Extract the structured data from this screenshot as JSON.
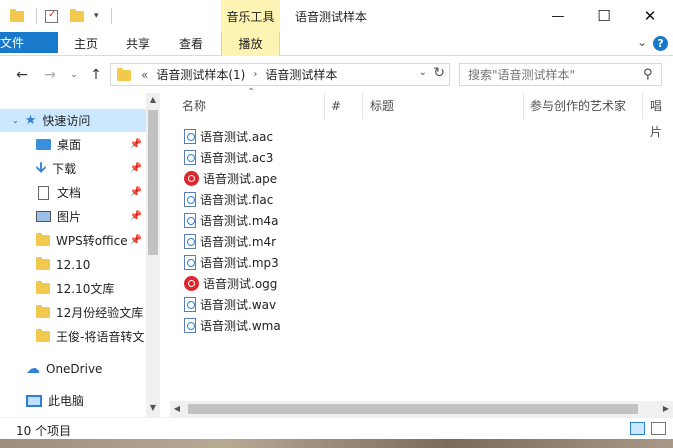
{
  "titlebar": {
    "contextual_tab_group": "音乐工具",
    "window_title": "语音测试样本",
    "minimize": "—",
    "maximize": "☐",
    "close": "✕"
  },
  "ribbon": {
    "tabs": [
      "文件",
      "主页",
      "共享",
      "查看",
      "播放"
    ],
    "help": "?"
  },
  "address": {
    "overflow": "«",
    "crumbs": [
      "语音测试样本(1)",
      "语音测试样本"
    ],
    "separator": "›"
  },
  "search": {
    "placeholder": "搜索\"语音测试样本\""
  },
  "navpane": {
    "items": [
      {
        "label": "快速访问",
        "icon": "star-icon"
      },
      {
        "label": "桌面",
        "icon": "desktop-icon",
        "pinned": true
      },
      {
        "label": "下载",
        "icon": "download-icon",
        "pinned": true
      },
      {
        "label": "文档",
        "icon": "document-icon",
        "pinned": true
      },
      {
        "label": "图片",
        "icon": "pictures-icon",
        "pinned": true
      },
      {
        "label": "WPS转office",
        "icon": "folder-icon",
        "pinned": true
      },
      {
        "label": "12.10",
        "icon": "folder-icon"
      },
      {
        "label": "12.10文库",
        "icon": "folder-icon"
      },
      {
        "label": "12月份经验文库",
        "icon": "folder-icon"
      },
      {
        "label": "王俊-将语音转文",
        "icon": "folder-icon"
      },
      {
        "label": "OneDrive",
        "icon": "onedrive-icon"
      },
      {
        "label": "此电脑",
        "icon": "this-pc-icon"
      }
    ]
  },
  "columns": [
    "名称",
    "#",
    "标题",
    "参与创作的艺术家",
    "唱片"
  ],
  "files": [
    {
      "name": "语音测试.aac",
      "icon": "audio-file-icon"
    },
    {
      "name": "语音测试.ac3",
      "icon": "audio-file-icon"
    },
    {
      "name": "语音测试.ape",
      "icon": "netease-music-icon"
    },
    {
      "name": "语音测试.flac",
      "icon": "audio-file-icon"
    },
    {
      "name": "语音测试.m4a",
      "icon": "audio-file-icon"
    },
    {
      "name": "语音测试.m4r",
      "icon": "audio-file-icon"
    },
    {
      "name": "语音测试.mp3",
      "icon": "audio-file-icon"
    },
    {
      "name": "语音测试.ogg",
      "icon": "netease-music-icon"
    },
    {
      "name": "语音测试.wav",
      "icon": "audio-file-icon"
    },
    {
      "name": "语音测试.wma",
      "icon": "audio-file-icon"
    }
  ],
  "status": {
    "item_count": "10 个项目"
  },
  "colors": {
    "accent": "#1979ca",
    "context_tab": "#fdf3b3",
    "selected": "#cce8ff"
  }
}
